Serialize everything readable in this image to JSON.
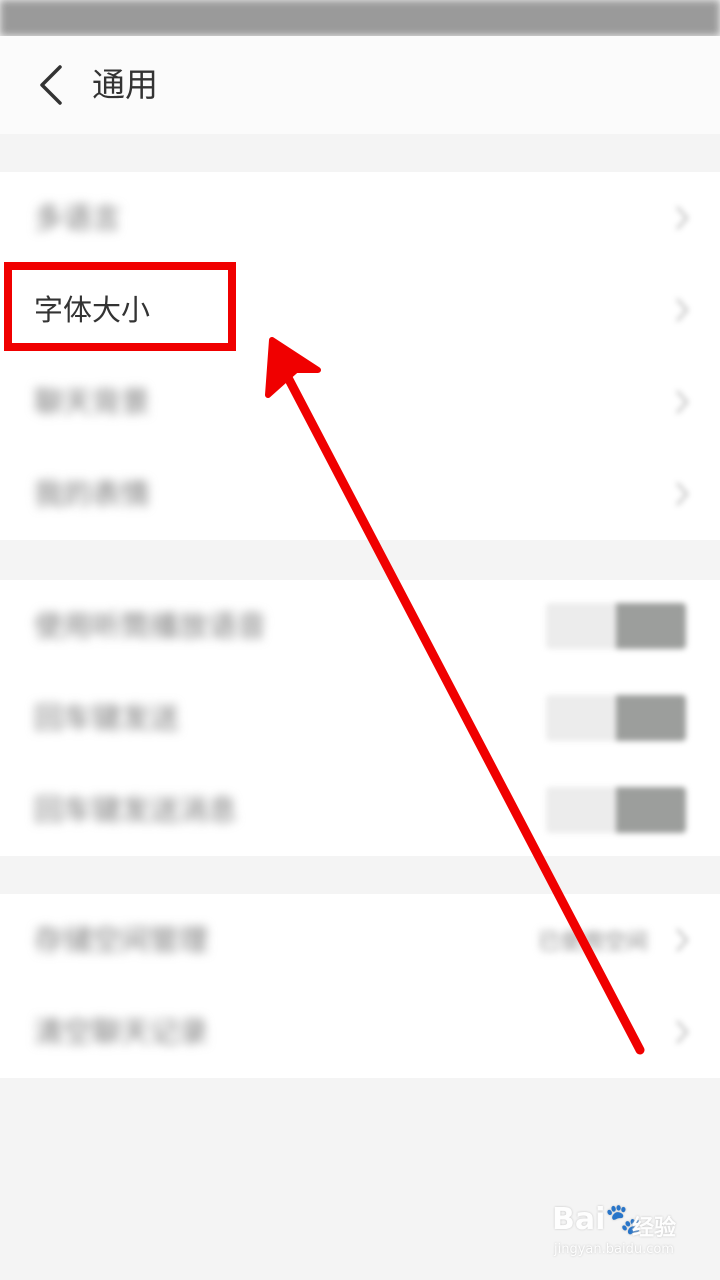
{
  "header": {
    "title": "通用"
  },
  "groups": [
    {
      "rows": [
        {
          "label": "多语言",
          "blurred": true,
          "control": "chevron"
        },
        {
          "label": "字体大小",
          "blurred": false,
          "control": "chevron"
        },
        {
          "label": "聊天背景",
          "blurred": true,
          "control": "chevron"
        },
        {
          "label": "我的表情",
          "blurred": true,
          "control": "chevron"
        }
      ]
    },
    {
      "rows": [
        {
          "label": "使用听筒播放语音",
          "blurred": true,
          "control": "toggle",
          "toggle_on": false
        },
        {
          "label": "回车键发送",
          "blurred": true,
          "control": "toggle",
          "toggle_on": false
        },
        {
          "label": "回车键发送消息",
          "blurred": true,
          "control": "toggle",
          "toggle_on": false
        }
      ]
    },
    {
      "rows": [
        {
          "label": "存储空间管理",
          "blurred": true,
          "control": "chevron",
          "value": "已使用空间"
        },
        {
          "label": "清空聊天记录",
          "blurred": true,
          "control": "chevron"
        }
      ]
    }
  ],
  "annotation": {
    "color": "#f00000",
    "target": "字体大小"
  },
  "watermark": {
    "brand": "Bai🐾",
    "cn": "经验",
    "url": "jingyan.baidu.com"
  }
}
